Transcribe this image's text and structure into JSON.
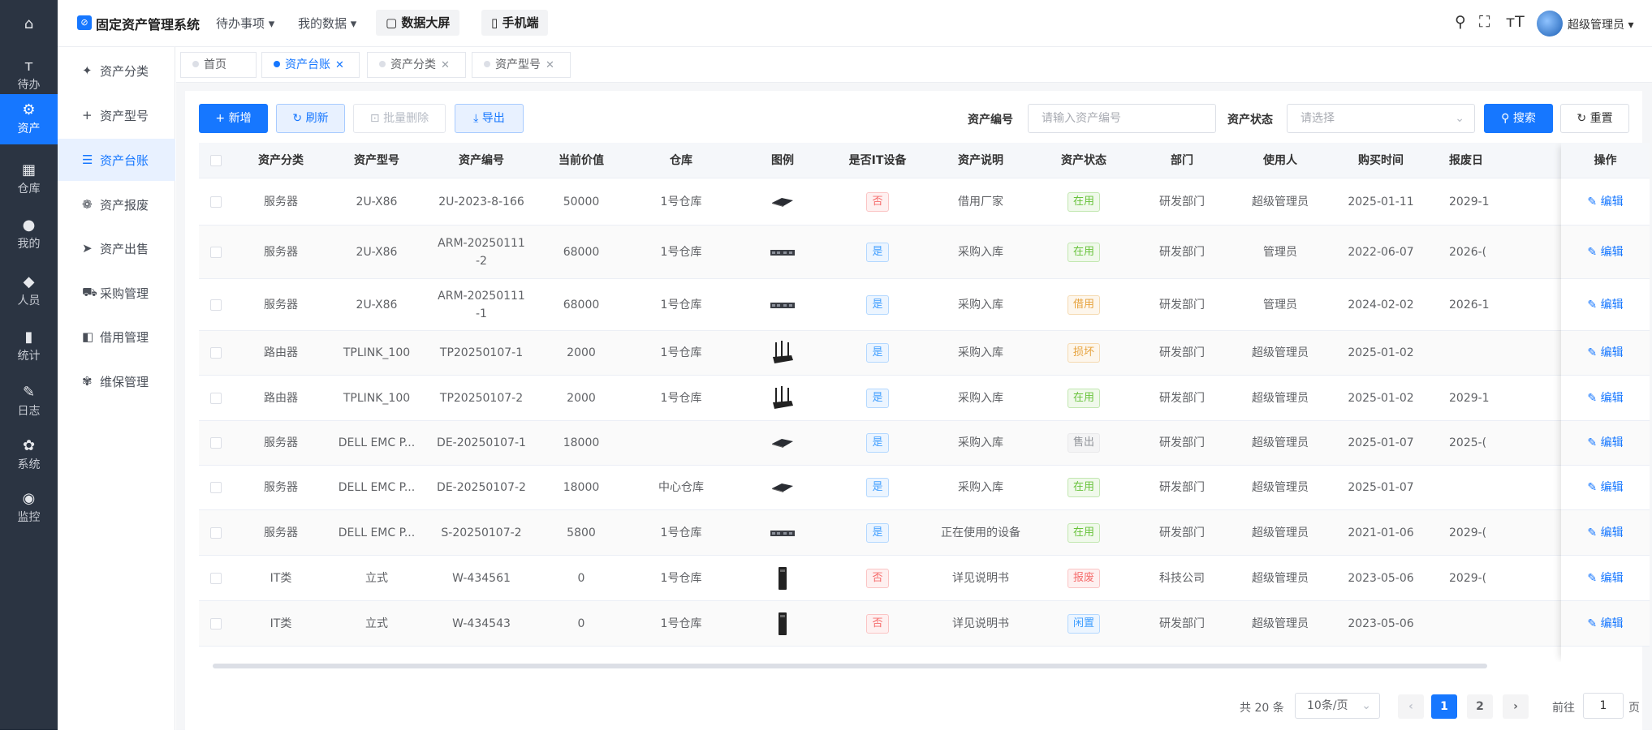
{
  "header": {
    "app_title": "固定资产管理系统",
    "nav_todo": "待办事项 ▾",
    "nav_mydata": "我的数据 ▾",
    "btn_bigscreen": "▢ 数据大屏",
    "btn_mobile": "▯ 手机端",
    "user_name": "超级管理员 ▾"
  },
  "rail": [
    {
      "icon": "⌂",
      "label": ""
    },
    {
      "icon": "ᴛ",
      "label": "待办"
    },
    {
      "icon": "⚙",
      "label": "资产"
    },
    {
      "icon": "▦",
      "label": "仓库"
    },
    {
      "icon": "●",
      "label": "我的"
    },
    {
      "icon": "◆",
      "label": "人员"
    },
    {
      "icon": "▮",
      "label": "统计"
    },
    {
      "icon": "✎",
      "label": "日志"
    },
    {
      "icon": "✿",
      "label": "系统"
    },
    {
      "icon": "◉",
      "label": "监控"
    }
  ],
  "sub_menu": [
    {
      "icon": "✦",
      "label": "资产分类"
    },
    {
      "icon": "+",
      "label": "资产型号"
    },
    {
      "icon": "☰",
      "label": "资产台账"
    },
    {
      "icon": "❁",
      "label": "资产报废"
    },
    {
      "icon": "➤",
      "label": "资产出售"
    },
    {
      "icon": "⛟",
      "label": "采购管理"
    },
    {
      "icon": "◧",
      "label": "借用管理"
    },
    {
      "icon": "✾",
      "label": "维保管理"
    }
  ],
  "tabs": [
    {
      "label": "首页"
    },
    {
      "label": "资产台账"
    },
    {
      "label": "资产分类"
    },
    {
      "label": "资产型号"
    }
  ],
  "toolbar": {
    "add": "+ 新增",
    "refresh": "↻ 刷新",
    "batch_delete": "⊡ 批量删除",
    "export": "⤓ 导出",
    "asset_no_label": "资产编号",
    "asset_no_placeholder": "请输入资产编号",
    "status_label": "资产状态",
    "status_placeholder": "请选择",
    "search": "⚲ 搜索",
    "reset": "↻ 重置"
  },
  "table": {
    "columns": [
      "资产分类",
      "资产型号",
      "资产编号",
      "当前价值",
      "仓库",
      "图例",
      "是否IT设备",
      "资产说明",
      "资产状态",
      "部门",
      "使用人",
      "购买时间",
      "报废日",
      "操作"
    ],
    "edit_label": "编辑",
    "rows": [
      {
        "category": "服务器",
        "model": "2U-X86",
        "code": "2U-2023-8-166",
        "value": "50000",
        "warehouse": "1号仓库",
        "img": "blade",
        "it": "否",
        "desc": "借用厂家",
        "status": "在用",
        "dept": "研发部门",
        "user": "超级管理员",
        "buy": "2025-01-11",
        "scrap": "2029-1"
      },
      {
        "category": "服务器",
        "model": "2U-X86",
        "code": "ARM-20250111\n-2",
        "value": "68000",
        "warehouse": "1号仓库",
        "img": "rack",
        "it": "是",
        "desc": "采购入库",
        "status": "在用",
        "dept": "研发部门",
        "user": "管理员",
        "buy": "2022-06-07",
        "scrap": "2026-("
      },
      {
        "category": "服务器",
        "model": "2U-X86",
        "code": "ARM-20250111\n-1",
        "value": "68000",
        "warehouse": "1号仓库",
        "img": "rack",
        "it": "是",
        "desc": "采购入库",
        "status": "借用",
        "dept": "研发部门",
        "user": "管理员",
        "buy": "2024-02-02",
        "scrap": "2026-1"
      },
      {
        "category": "路由器",
        "model": "TPLINK_100",
        "code": "TP20250107-1",
        "value": "2000",
        "warehouse": "1号仓库",
        "img": "router",
        "it": "是",
        "desc": "采购入库",
        "status": "损坏",
        "dept": "研发部门",
        "user": "超级管理员",
        "buy": "2025-01-02",
        "scrap": ""
      },
      {
        "category": "路由器",
        "model": "TPLINK_100",
        "code": "TP20250107-2",
        "value": "2000",
        "warehouse": "1号仓库",
        "img": "router",
        "it": "是",
        "desc": "采购入库",
        "status": "在用",
        "dept": "研发部门",
        "user": "超级管理员",
        "buy": "2025-01-02",
        "scrap": "2029-1"
      },
      {
        "category": "服务器",
        "model": "DELL EMC P...",
        "code": "DE-20250107-1",
        "value": "18000",
        "warehouse": "",
        "img": "blade",
        "it": "是",
        "desc": "采购入库",
        "status": "售出",
        "dept": "研发部门",
        "user": "超级管理员",
        "buy": "2025-01-07",
        "scrap": "2025-("
      },
      {
        "category": "服务器",
        "model": "DELL EMC P...",
        "code": "DE-20250107-2",
        "value": "18000",
        "warehouse": "中心仓库",
        "img": "blade",
        "it": "是",
        "desc": "采购入库",
        "status": "在用",
        "dept": "研发部门",
        "user": "超级管理员",
        "buy": "2025-01-07",
        "scrap": ""
      },
      {
        "category": "服务器",
        "model": "DELL EMC P...",
        "code": "S-20250107-2",
        "value": "5800",
        "warehouse": "1号仓库",
        "img": "rack",
        "it": "是",
        "desc": "正在使用的设备",
        "status": "在用",
        "dept": "研发部门",
        "user": "超级管理员",
        "buy": "2021-01-06",
        "scrap": "2029-("
      },
      {
        "category": "IT类",
        "model": "立式",
        "code": "W-434561",
        "value": "0",
        "warehouse": "1号仓库",
        "img": "tower",
        "it": "否",
        "desc": "详见说明书",
        "status": "报废",
        "dept": "科技公司",
        "user": "超级管理员",
        "buy": "2023-05-06",
        "scrap": "2029-("
      },
      {
        "category": "IT类",
        "model": "立式",
        "code": "W-434543",
        "value": "0",
        "warehouse": "1号仓库",
        "img": "tower",
        "it": "否",
        "desc": "详见说明书",
        "status": "闲置",
        "dept": "研发部门",
        "user": "超级管理员",
        "buy": "2023-05-06",
        "scrap": ""
      }
    ]
  },
  "status_colors": {
    "在用": "green",
    "借用": "orange",
    "损坏": "orange",
    "售出": "gray",
    "报废": "red",
    "闲置": "blue"
  },
  "pagination": {
    "total": "共 20 条",
    "page_size": "10条/页",
    "prev": "‹",
    "pages": [
      "1",
      "2"
    ],
    "next": "›",
    "goto_label": "前往",
    "goto_value": "1",
    "unit": "页"
  },
  "colors": {
    "accent": "#1677ff",
    "rail_bg": "#2b3442"
  }
}
